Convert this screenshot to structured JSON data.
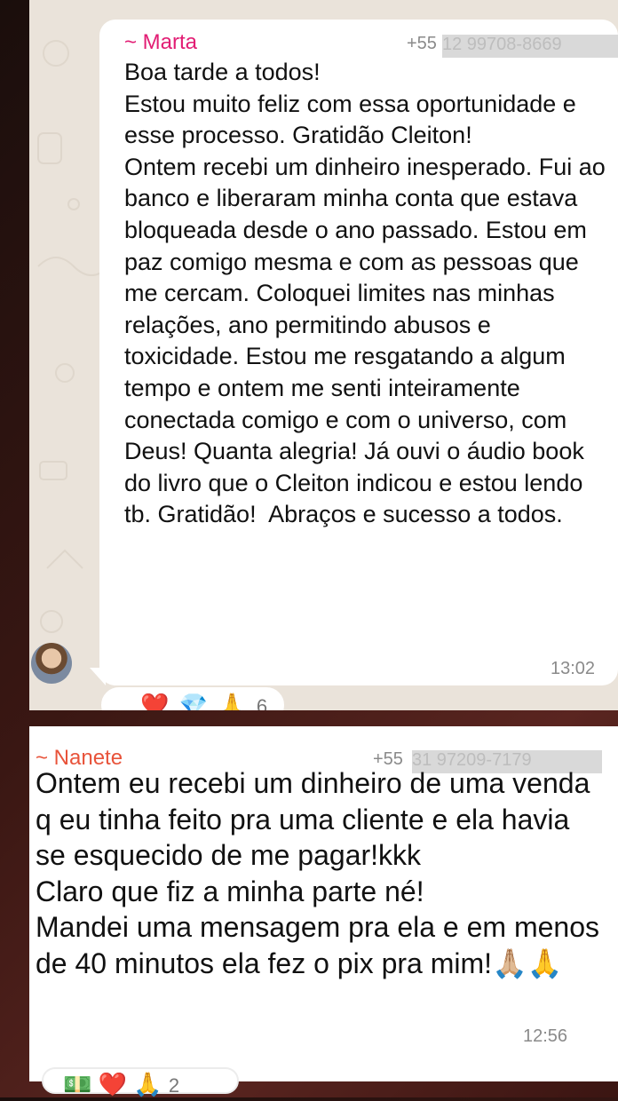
{
  "messages": [
    {
      "sender": "~ Marta",
      "phone_prefix": "+55",
      "phone_redacted": "12 99708-8669",
      "text": "Boa tarde a todos!\nEstou muito feliz com essa oportunidade e esse processo. Gratidão Cleiton!\nOntem recebi um dinheiro inesperado. Fui ao banco e liberaram minha conta que estava bloqueada desde o ano passado. Estou em paz comigo mesma e com as pessoas que me cercam. Coloquei limites nas minhas relações, ano permitindo abusos e toxicidade. Estou me resgatando a algum tempo e ontem me senti inteiramente conectada comigo e com o universo, com Deus! Quanta alegria! Já ouvi o áudio book do livro que o Cleiton indicou e estou lendo tb. Gratidão!  Abraços e sucesso a todos.",
      "time": "13:02",
      "reactions": [
        "❤️",
        "💎",
        "🙏"
      ],
      "reaction_count": "6"
    },
    {
      "sender": "~ Nanete",
      "phone_prefix": "+55",
      "phone_redacted": "31 97209-7179",
      "text": "Ontem eu recebi um dinheiro de uma venda q eu tinha feito pra uma cliente e ela havia se esquecido de me pagar!kkk\nClaro que fiz a minha parte né!\nMandei uma mensagem pra ela e em menos de 40 minutos ela fez o pix pra mim!🙏🏼🙏",
      "time": "12:56",
      "reactions": [
        "💵",
        "❤️",
        "🙏"
      ],
      "reaction_count": "2"
    }
  ],
  "colors": {
    "sender1": "#e21d74",
    "sender2": "#e8533a",
    "bubble": "#ffffff",
    "chat_wallpaper": "#eae3da"
  }
}
